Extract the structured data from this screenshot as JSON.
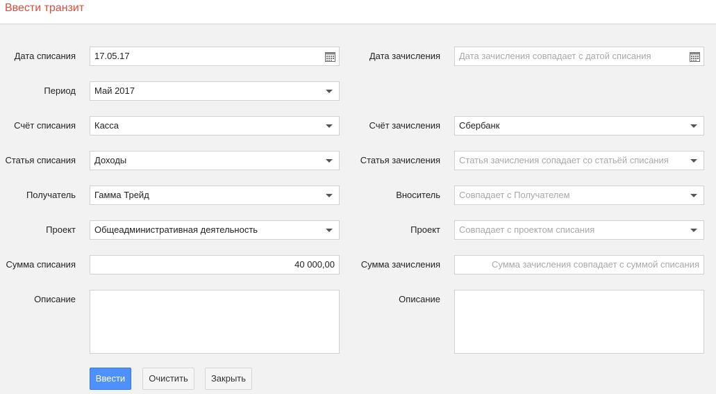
{
  "header": {
    "title": "Ввести транзит"
  },
  "left": {
    "write_off_date": {
      "label": "Дата списания",
      "value": "17.05.17"
    },
    "period": {
      "label": "Период",
      "value": "Май 2017"
    },
    "account": {
      "label": "Счёт списания",
      "value": "Касса"
    },
    "article": {
      "label": "Статья списания",
      "value": "Доходы"
    },
    "recipient": {
      "label": "Получатель",
      "value": "Гамма Трейд"
    },
    "project": {
      "label": "Проект",
      "value": "Общеадминистративная деятельность"
    },
    "amount": {
      "label": "Сумма списания",
      "value": "40 000,00"
    },
    "description": {
      "label": "Описание",
      "value": ""
    }
  },
  "right": {
    "credit_date": {
      "label": "Дата зачисления",
      "placeholder": "Дата зачисления совпадает с датой списания"
    },
    "account": {
      "label": "Счёт зачисления",
      "value": "Сбербанк"
    },
    "article": {
      "label": "Статья зачисления",
      "placeholder": "Статья зачисления сопадает со статьёй списания"
    },
    "depositor": {
      "label": "Вноситель",
      "placeholder": "Совпадает с Получателем"
    },
    "project": {
      "label": "Проект",
      "placeholder": "Совпадает с проектом списания"
    },
    "amount": {
      "label": "Сумма зачисления",
      "placeholder": "Сумма зачисления совпадает с суммой списания"
    },
    "description": {
      "label": "Описание",
      "value": ""
    }
  },
  "buttons": {
    "submit": "Ввести",
    "clear": "Очистить",
    "close": "Закрыть"
  },
  "colors": {
    "title": "#dd4b39",
    "primary_button": "#4d90fe"
  }
}
